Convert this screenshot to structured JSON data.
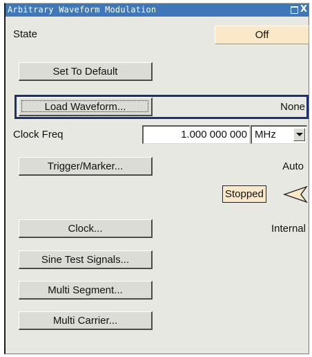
{
  "window": {
    "title": "Arbitrary Waveform Modulation",
    "maximize_icon": "maximize-icon",
    "close_icon": "close-icon",
    "close_glyph": "X"
  },
  "state": {
    "label": "State",
    "value": "Off"
  },
  "buttons": {
    "set_default": "Set To Default",
    "load_waveform": "Load Waveform...",
    "trigger_marker": "Trigger/Marker...",
    "clock": "Clock...",
    "sine_test": "Sine Test Signals...",
    "multi_segment": "Multi Segment...",
    "multi_carrier": "Multi Carrier..."
  },
  "load_waveform": {
    "value": "None"
  },
  "clock_freq": {
    "label": "Clock Freq",
    "value": "1.000 000 000",
    "unit": "MHz"
  },
  "trigger": {
    "value": "Auto",
    "status": "Stopped",
    "status_icon": "stopped-arrow-icon"
  },
  "clock": {
    "value": "Internal"
  },
  "colors": {
    "title_bar": "#3f77b8",
    "panel_bg": "#e8e8e2",
    "highlight_field": "#fae8c8",
    "focus_border": "#1c2e74"
  }
}
